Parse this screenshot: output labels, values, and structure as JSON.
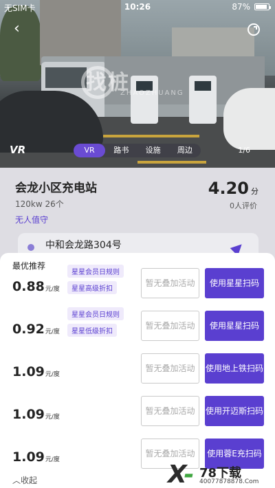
{
  "status_bar": {
    "carrier": "无SIM卡",
    "time": "10:26",
    "battery": "87%",
    "battery_level": 0.87
  },
  "photo": {
    "vr_logo": "VR",
    "tabs": [
      {
        "label": "VR",
        "active": true
      },
      {
        "label": "路书",
        "active": false
      },
      {
        "label": "设施",
        "active": false
      },
      {
        "label": "周边",
        "active": false
      }
    ],
    "page_indicator": "1/6",
    "watermark": "找桩",
    "watermark_sub": "ZHAOZHUANG"
  },
  "station": {
    "name": "会龙小区充电站",
    "meta": "120kw 26个",
    "tag": "无人值守",
    "price": "4.20",
    "price_unit": "分",
    "reviews": "0人评价",
    "address": "中和会龙路304号"
  },
  "sheet": {
    "best_label": "最优推荐",
    "rows": [
      {
        "price": "0.88",
        "unit": "元/度",
        "badges": [
          "星星会员日规则",
          "星星高级折扣"
        ],
        "none_label": "暂无叠加活动",
        "scan_label": "使用星星扫码"
      },
      {
        "price": "0.92",
        "unit": "元/度",
        "badges": [
          "星星会员日规则",
          "星星低级折扣"
        ],
        "none_label": "暂无叠加活动",
        "scan_label": "使用星星扫码"
      },
      {
        "price": "1.09",
        "unit": "元/度",
        "badges": [],
        "none_label": "暂无叠加活动",
        "scan_label": "使用地上铁扫码"
      },
      {
        "price": "1.09",
        "unit": "元/度",
        "badges": [],
        "none_label": "暂无叠加活动",
        "scan_label": "使用开迈斯扫码"
      },
      {
        "price": "1.09",
        "unit": "元/度",
        "badges": [],
        "none_label": "暂无叠加活动",
        "scan_label": "使用蓉E充扫码"
      }
    ],
    "collapse_label": "收起"
  },
  "ad": {
    "brand": "78下载",
    "url": "40077878878.Com"
  },
  "colors": {
    "accent": "#5a3fd0",
    "badge_bg": "#efeafb"
  }
}
